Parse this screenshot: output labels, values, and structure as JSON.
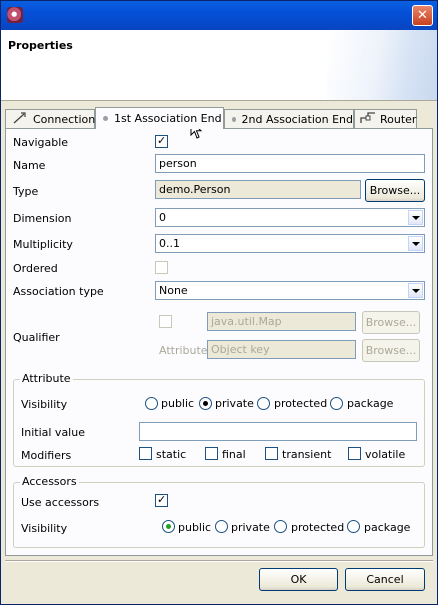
{
  "header": {
    "title": "Properties"
  },
  "tabs": [
    {
      "label": "Connection",
      "icon": "connection-icon"
    },
    {
      "label": "1st Association End",
      "icon": "dot-icon"
    },
    {
      "label": "2nd Association End",
      "icon": "dot-icon"
    },
    {
      "label": "Router",
      "icon": "router-icon"
    }
  ],
  "form": {
    "navigable_label": "Navigable",
    "navigable_checked": true,
    "name_label": "Name",
    "name_value": "person",
    "type_label": "Type",
    "type_value": "demo.Person",
    "browse_label": "Browse...",
    "dimension_label": "Dimension",
    "dimension_value": "0",
    "multiplicity_label": "Multiplicity",
    "multiplicity_value": "0..1",
    "ordered_label": "Ordered",
    "ordered_checked": false,
    "assoc_type_label": "Association type",
    "assoc_type_value": "None",
    "qualifier_label": "Qualifier",
    "qualifier_type_value": "java.util.Map",
    "qualifier_browse_label": "Browse...",
    "qualifier_attr_label": "Attribute",
    "qualifier_attr_value": "Object key",
    "qualifier_attr_browse_label": "Browse..."
  },
  "attribute_group": {
    "title": "Attribute",
    "visibility_label": "Visibility",
    "visibility_options": [
      "public",
      "private",
      "protected",
      "package"
    ],
    "visibility_selected": "private",
    "initial_value_label": "Initial value",
    "initial_value": "",
    "modifiers_label": "Modifiers",
    "modifiers": [
      "static",
      "final",
      "transient",
      "volatile"
    ]
  },
  "accessors_group": {
    "title": "Accessors",
    "use_accessors_label": "Use accessors",
    "use_accessors_checked": true,
    "visibility_label": "Visibility",
    "visibility_options": [
      "public",
      "private",
      "protected",
      "package"
    ],
    "visibility_selected": "public"
  },
  "footer": {
    "ok_label": "OK",
    "cancel_label": "Cancel"
  },
  "colors": {
    "titlebar": "#0550d8",
    "dialog_bg": "#ece9d8",
    "panel_bg": "#fcfcfe",
    "radio_selected": "#21a121"
  }
}
